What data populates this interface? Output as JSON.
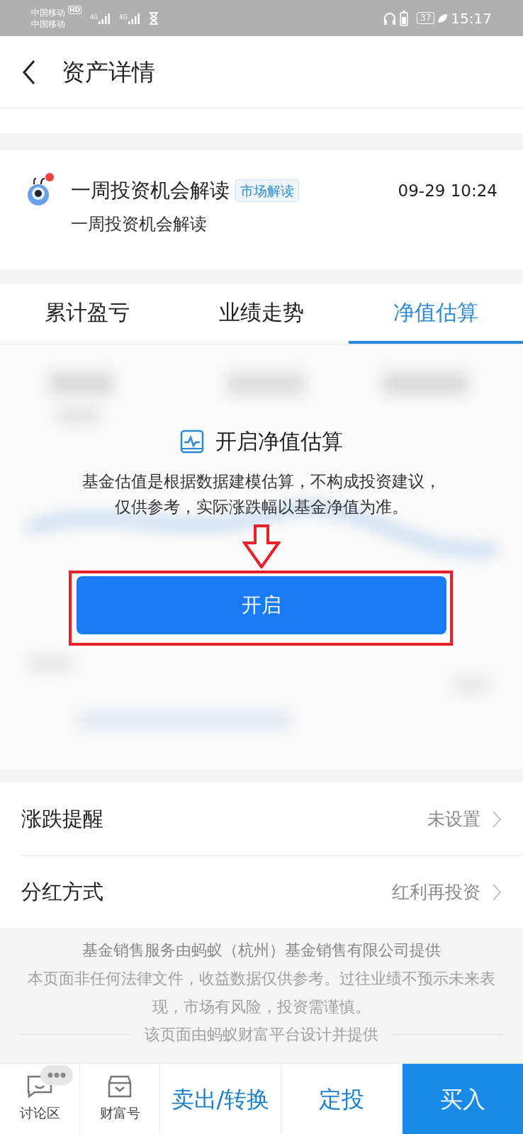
{
  "status_bar": {
    "carrier_1": "中国移动",
    "carrier_2": "中国移动",
    "hd": "HD",
    "network_1": "4G",
    "network_2": "4G",
    "battery": "37",
    "time": "15:17"
  },
  "header": {
    "title": "资产详情"
  },
  "news": {
    "title": "一周投资机会解读",
    "tag": "市场解读",
    "time": "09-29 10:24",
    "summary": "一周投资机会解读",
    "unread": true
  },
  "tabs": [
    {
      "label": "累计盈亏",
      "selected": false
    },
    {
      "label": "业绩走势",
      "selected": false
    },
    {
      "label": "净值估算",
      "selected": true
    }
  ],
  "estimate": {
    "title": "开启净值估算",
    "description": "基金估值是根据数据建模估算，不构成投资建议，仅供参考，实际涨跌幅以基金净值为准。",
    "button": "开启"
  },
  "settings": [
    {
      "label": "涨跌提醒",
      "value": "未设置"
    },
    {
      "label": "分红方式",
      "value": "红利再投资"
    }
  ],
  "footer": {
    "provider": "基金销售服务由蚂蚁（杭州）基金销售有限公司提供",
    "disclaimer": "本页面非任何法律文件，收益数据仅供参考。过往业绩不预示未来表现，市场有风险，投资需谨慎。",
    "platform": "该页面由蚂蚁财富平台设计并提供"
  },
  "bottom_bar": {
    "icon_items": [
      {
        "label": "讨论区",
        "kind": "chat"
      },
      {
        "label": "财富号",
        "kind": "shop"
      }
    ],
    "actions": [
      {
        "label": "卖出/转换",
        "primary": false
      },
      {
        "label": "定投",
        "primary": false
      },
      {
        "label": "买入",
        "primary": true
      }
    ]
  }
}
